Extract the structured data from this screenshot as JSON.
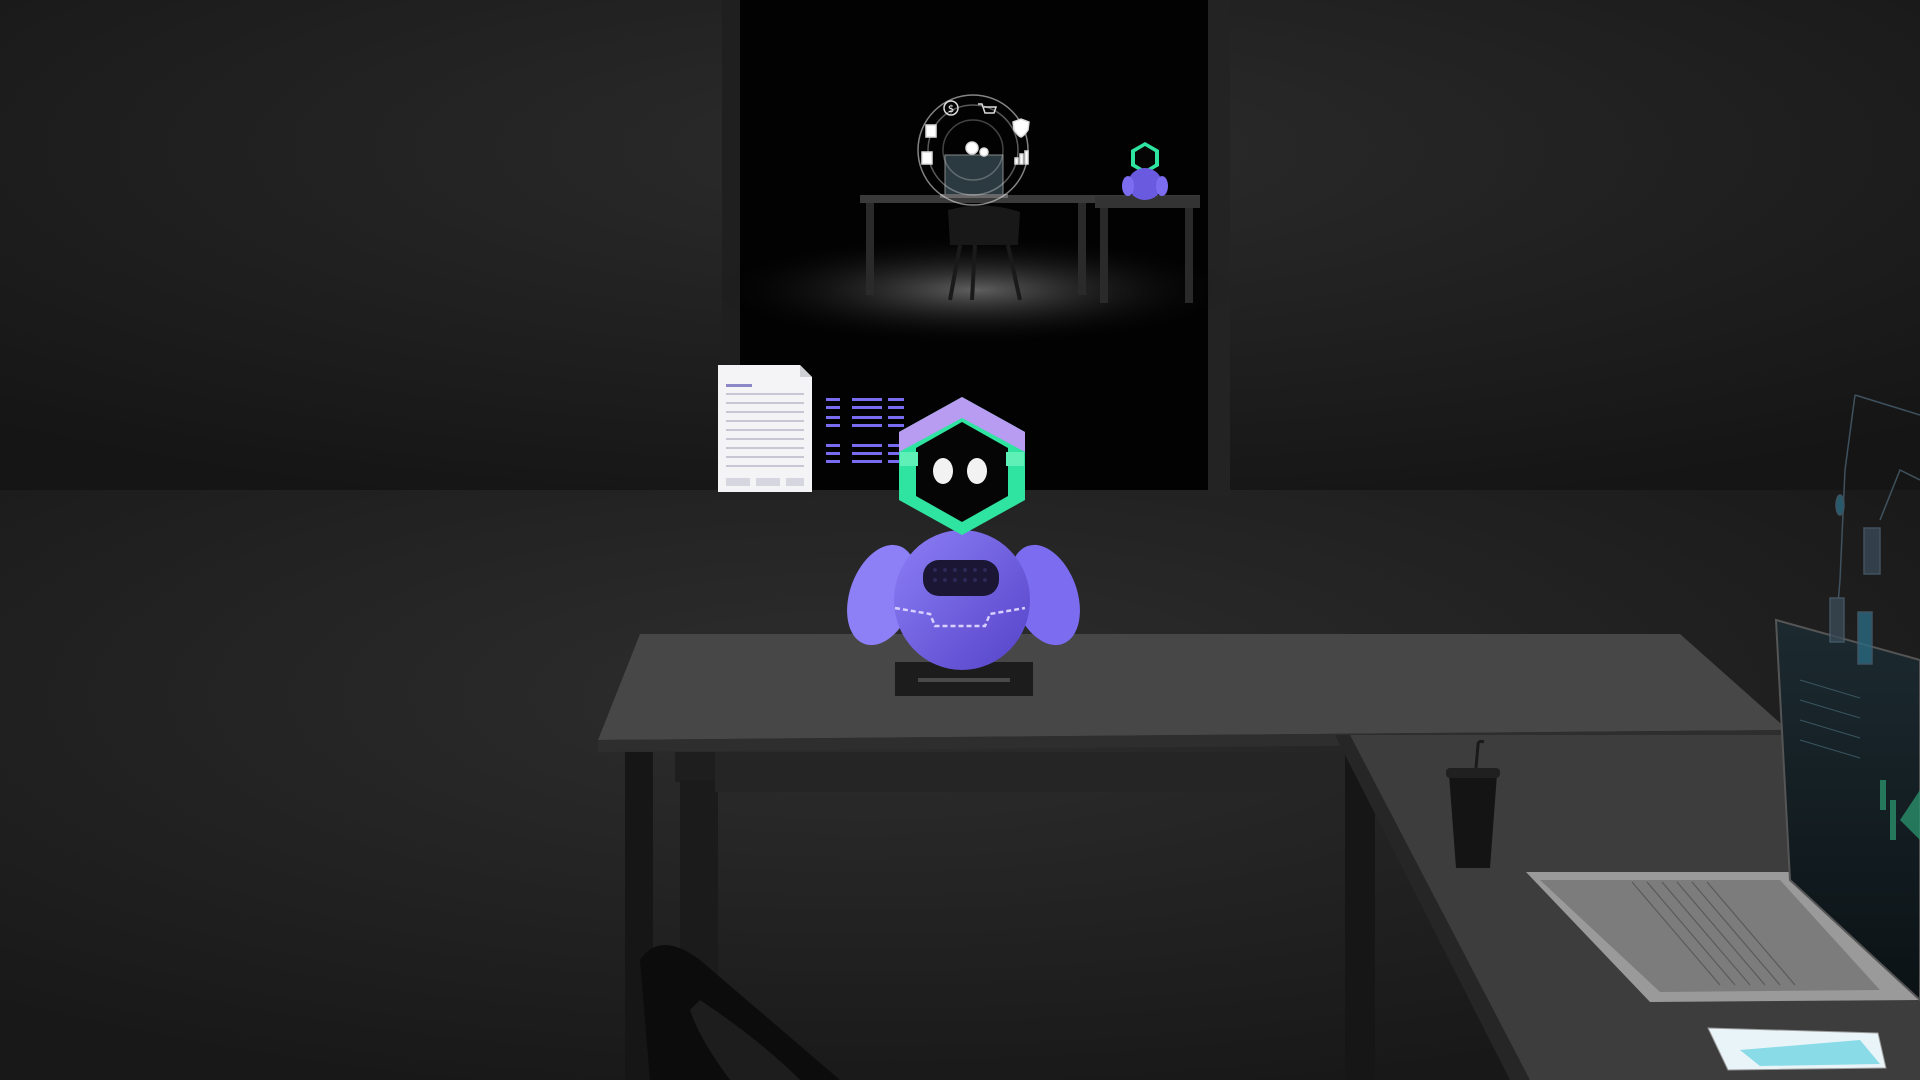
{
  "scene": {
    "colors": {
      "background": "#1b1b1b",
      "floor": "#262626",
      "back_room": "#050505",
      "desk_top": "#454545",
      "desk_edge": "#2a2a2a",
      "robot_body": "#7b6cf0",
      "robot_body_shade": "#5b4bd0",
      "robot_head_frame": "#2fe3a0",
      "robot_head_top": "#b79cf2",
      "robot_face": "#050505",
      "robot_eyes": "#f2f2f2",
      "hologram_lines": "#7a6cf0",
      "document": "#f4f4f6"
    },
    "icons": [
      "robot-character",
      "floating-document-icon",
      "data-list-icon",
      "dollar-icon",
      "shopping-cart-icon",
      "shield-check-icon",
      "gear-icon",
      "calculator-icon",
      "bar-chart-icon",
      "receipt-icon",
      "laptop",
      "drink-cup",
      "desk-chair",
      "phone"
    ]
  }
}
